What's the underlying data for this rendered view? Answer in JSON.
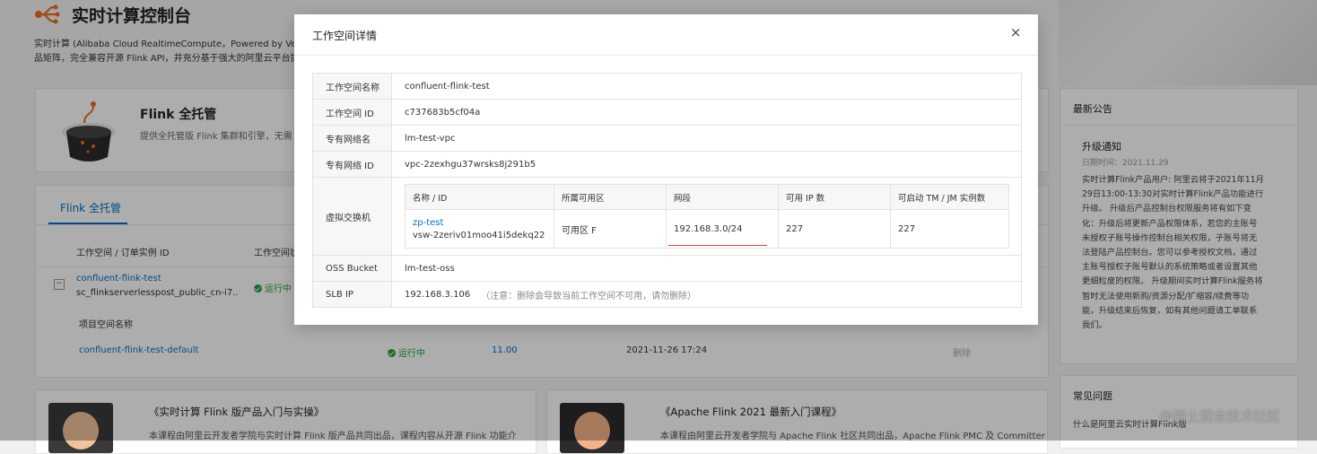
{
  "header": {
    "title": "实时计算控制台",
    "desc_line1": "实时计算 (Alibaba Cloud RealtimeCompute，Powered by Ververica) 是",
    "desc_line2": "品矩阵，完全兼容开源 Flink API，并充分基于强大的阿里云平台提"
  },
  "flink_card": {
    "title": "Flink 全托管",
    "desc": "提供全托管版 Flink 集群和引擎，无需"
  },
  "workspace_list": {
    "tab": "Flink 全托管",
    "col_instance": "工作空间 / 订单实例 ID",
    "col_status": "工作空间状",
    "row_name": "confluent-flink-test",
    "row_id": "sc_flinkserverlesspost_public_cn-i7...",
    "row_status": "运行中",
    "toggle": "−",
    "sub_header": "项目空间名称",
    "sub_name": "confluent-flink-test-default",
    "sub_status": "运行中",
    "sub_version": "11.00",
    "sub_time": "2021-11-26 17:24",
    "sub_action": "删除"
  },
  "notice": {
    "title": "最新公告",
    "item_title": "升级通知",
    "item_date": "日期时间：2021.11.29",
    "item_body": [
      "实时计算Flink产品用户: 阿里云将于2021年11月",
      "29日13:00-13:30对实时计算Flink产品功能进行",
      "升级。 升级后产品控制台权限服务将有如下变",
      "化：升级后将更新产品权限体系，若您的主账号",
      "未授权子账号操作控制台相关权限，子账号将无",
      "法登陆产品控制台。您可以参考授权文档，通过",
      "主账号授权子账号默认的系统策略或者设置其他",
      "更细粒度的权限。 升级期间实时计算Flink服务将",
      "暂时无法使用新购/资源分配/扩缩容/续费等功",
      "能，升级结束后恢复，如有其他问题请工单联系",
      "我们。"
    ]
  },
  "faq": {
    "title": "常见问题",
    "item1": "什么是阿里云实时计算Flink版"
  },
  "courses": [
    {
      "title": "《实时计算 Flink 版产品入门与实操》",
      "desc": "本课程由阿里云开发者学院与实时计算 Flink 版产品共同出品，课程内容从开源 Flink 功能介"
    },
    {
      "title": "《Apache Flink 2021 最新入门课程》",
      "desc": "本课程由阿里云开发者学院与 Apache Flink 社区共同出品，Apache Flink PMC 及 Committer"
    }
  ],
  "watermark": "@稀土掘金技术社区",
  "dialog": {
    "title": "工作空间详情",
    "close_label": "×",
    "rows": {
      "ws_name_label": "工作空间名称",
      "ws_name": "confluent-flink-test",
      "ws_id_label": "工作空间 ID",
      "ws_id": "c737683b5cf04a",
      "vpc_name_label": "专有网络名",
      "vpc_name": "lm-test-vpc",
      "vpc_id_label": "专有网络 ID",
      "vpc_id": "vpc-2zexhgu37wrsks8j291b5",
      "vswitch_label": "虚拟交换机",
      "oss_label": "OSS Bucket",
      "oss": "lm-test-oss",
      "slb_label": "SLB IP",
      "slb": "192.168.3.106",
      "slb_note": "（注意：删除会导致当前工作空间不可用，请勿删除）"
    },
    "vswitch": {
      "headers": [
        "名称 / ID",
        "所属可用区",
        "网段",
        "可用 IP 数",
        "可启动 TM / JM 实例数"
      ],
      "name": "zp-test",
      "id": "vsw-2zeriv01moo41i5dekq22",
      "zone": "可用区 F",
      "cidr": "192.168.3.0/24",
      "available_ip": "227",
      "startable": "227"
    }
  }
}
